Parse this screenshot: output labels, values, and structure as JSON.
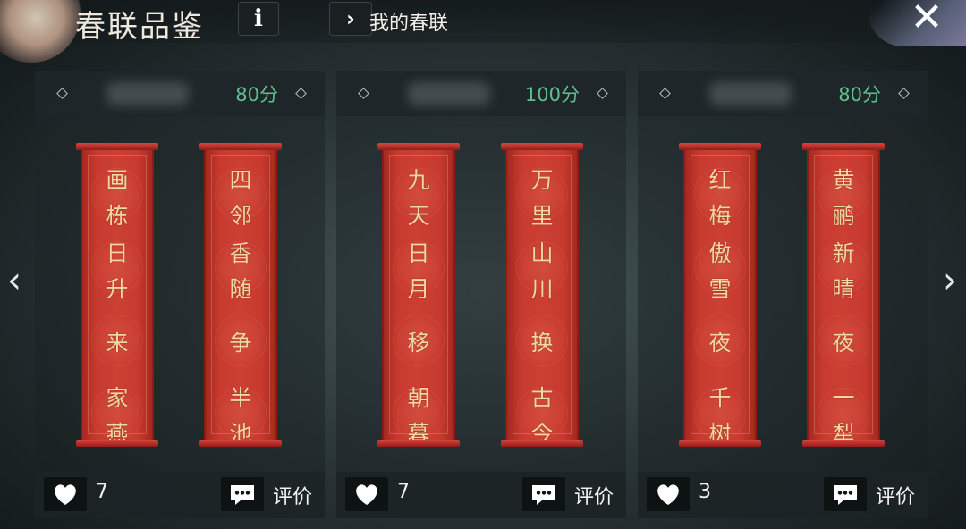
{
  "header": {
    "title": "春联品鉴",
    "info_icon": "i",
    "mine_icon": "›",
    "mine_label": "我的春联",
    "close_icon": "✕"
  },
  "nav": {
    "prev_icon": "‹",
    "next_icon": "›"
  },
  "cards": [
    {
      "score": "80分",
      "left_chars": [
        "画",
        "栋",
        "日",
        "升",
        "来",
        "家",
        "燕"
      ],
      "right_chars": [
        "四",
        "邻",
        "香",
        "随",
        "争",
        "半",
        "池"
      ],
      "likes": "7",
      "comment_label": "评价"
    },
    {
      "score": "100分",
      "left_chars": [
        "九",
        "天",
        "日",
        "月",
        "移",
        "朝",
        "暮"
      ],
      "right_chars": [
        "万",
        "里",
        "山",
        "川",
        "换",
        "古",
        "今"
      ],
      "likes": "7",
      "comment_label": "评价"
    },
    {
      "score": "80分",
      "left_chars": [
        "红",
        "梅",
        "傲",
        "雪",
        "夜",
        "千",
        "树"
      ],
      "right_chars": [
        "黄",
        "鹂",
        "新",
        "晴",
        "夜",
        "一",
        "犁"
      ],
      "likes": "3",
      "comment_label": "评价"
    }
  ],
  "colors": {
    "score_green": "#5fbf8e",
    "scroll_red": "#c73a2f",
    "scroll_text_gold": "#f1d8a0"
  }
}
